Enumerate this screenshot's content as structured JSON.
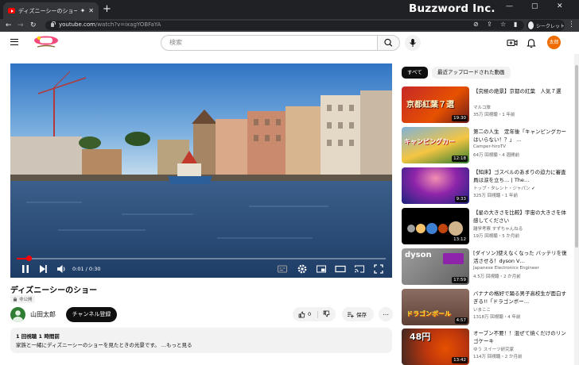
{
  "browser": {
    "tab_title": "ディズニーシーのショー - YouTube",
    "url_host": "youtube.com",
    "url_path": "/watch?v=ixagYOBFaYA",
    "profile_label": "シークレット",
    "watermark": "Buzzword Inc."
  },
  "header": {
    "search_placeholder": "検索",
    "avatar_text": "太郎"
  },
  "player": {
    "time": "0:01 / 0:30",
    "progress": 0.033
  },
  "video": {
    "title": "ディズニーシーのショー",
    "privacy": "非公開",
    "channel": "山田太郎",
    "subscribe_label": "チャンネル登録",
    "likes": "0",
    "save_label": "保存",
    "stats": "1 回視聴  1 時間前",
    "description": "家族と一緒にディズニーシーのショーを見たときの光景です。  ...もっと見る"
  },
  "sidebar": {
    "chips": [
      "すべて",
      "最近アップロードされた動画"
    ],
    "items": [
      {
        "title": "【究極の絶景】京都の紅葉　人気７選",
        "channel": "マルコ旅",
        "meta": "35万 回視聴・1 年前",
        "duration": "19:30",
        "thumb_text": "京都紅葉７選"
      },
      {
        "title": "第二の人生　定年後「キャンピングカーはいらない！？」 …",
        "channel": "Camper-hiroTV",
        "meta": "64万 回視聴・4 週間前",
        "duration": "12:18",
        "thumb_text": "キャンピングカー"
      },
      {
        "title": "【知床】ゴスペルのあまりの迫力に審査員は涙を立ち… | The…",
        "channel": "トップ・タレント・ジャパン",
        "meta": "325万 回視聴・1 年前",
        "duration": "9:33",
        "thumb_text": ""
      },
      {
        "title": "【星の大きさを比較】宇宙の大きさを体感してください",
        "channel": "雑学考察 すずちゃんねる",
        "meta": "19万 回視聴・5 か月前",
        "duration": "13:12",
        "thumb_text": ""
      },
      {
        "title": "[ダイソン]使えなくなった バッテリを復活させる！dyson V…",
        "channel": "Japanese Electronics Engineer",
        "meta": "4.5万 回視聴・2 か月前",
        "duration": "17:59",
        "thumb_text": "dyson"
      },
      {
        "title": "バナナの格好で踊る男子高校生が面白すぎる!!「ドラゴンボー…",
        "channel": "いまここ",
        "meta": "1318万 回視聴・4 年前",
        "duration": "4:57",
        "thumb_text": "ドラゴンボール"
      },
      {
        "title": "オーブン不要！！混ぜて焼くだけのリンゴケーキ",
        "channel": "ゆう スイーツ研究家",
        "meta": "114万 回視聴・2 か月前",
        "duration": "13:42",
        "thumb_text": "48円"
      }
    ]
  },
  "colors": {
    "accent": "#ff0000",
    "avatar": "#ef6c00",
    "chrome_dark": "#202124"
  }
}
